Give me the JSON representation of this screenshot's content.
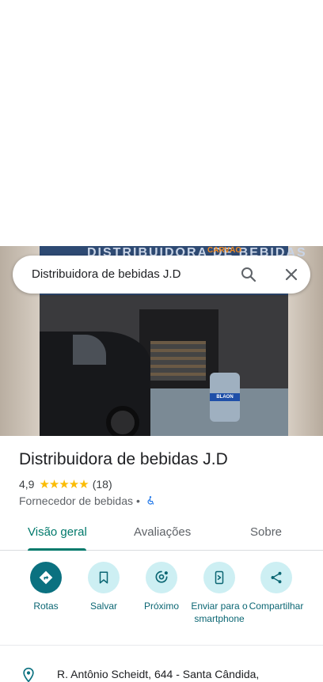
{
  "search": {
    "query": "Distribuidora de bebidas J.D"
  },
  "photo": {
    "sign_text": "DISTRIBUIDORA DE BEBIDAS",
    "sign_orange": "CARVÃO",
    "barrel_text": "BLAON"
  },
  "place": {
    "name": "Distribuidora de bebidas J.D",
    "rating": "4,9",
    "stars": "★★★★★",
    "review_count": "(18)",
    "category": "Fornecedor de bebidas",
    "separator": "•"
  },
  "tabs": [
    {
      "label": "Visão geral"
    },
    {
      "label": "Avaliações"
    },
    {
      "label": "Sobre"
    }
  ],
  "actions": [
    {
      "label": "Rotas",
      "icon": "directions-icon"
    },
    {
      "label": "Salvar",
      "icon": "bookmark-icon"
    },
    {
      "label": "Próximo",
      "icon": "nearby-icon"
    },
    {
      "label": "Enviar para o smartphone",
      "icon": "send-to-phone-icon"
    },
    {
      "label": "Compartilhar",
      "icon": "share-icon"
    }
  ],
  "address": {
    "text": "R. Antônio Scheidt, 644 - Santa Cândida,"
  },
  "colors": {
    "accent": "#00796b",
    "action_bg": "#cdeff3",
    "primary_action": "#0b7180",
    "star": "#fbbc04"
  }
}
